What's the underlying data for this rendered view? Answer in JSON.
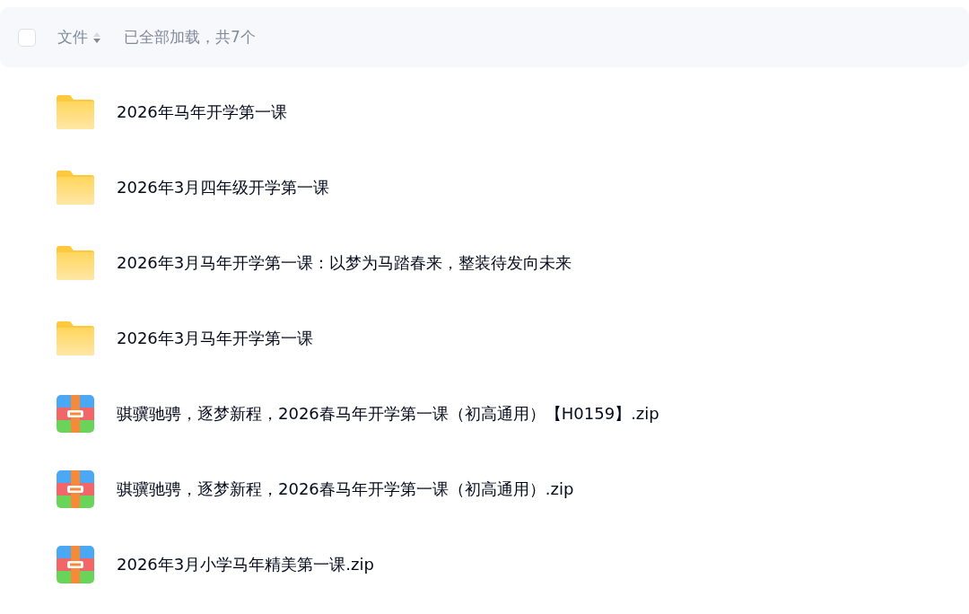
{
  "header": {
    "checked": false,
    "column": "文件",
    "status": "已全部加载，共7个"
  },
  "files": [
    {
      "kind": "folder",
      "name": "2026年马年开学第一课"
    },
    {
      "kind": "folder",
      "name": "2026年3月四年级开学第一课"
    },
    {
      "kind": "folder",
      "name": "2026年3月马年开学第一课：以梦为马踏春来，整装待发向未来"
    },
    {
      "kind": "folder",
      "name": "2026年3月马年开学第一课"
    },
    {
      "kind": "zip",
      "name": "骐骥驰骋，逐梦新程，2026春马年开学第一课（初高通用）【H0159】.zip"
    },
    {
      "kind": "zip",
      "name": "骐骥驰骋，逐梦新程，2026春马年开学第一课（初高通用）.zip"
    },
    {
      "kind": "zip",
      "name": "2026年3月小学马年精美第一课.zip"
    }
  ]
}
